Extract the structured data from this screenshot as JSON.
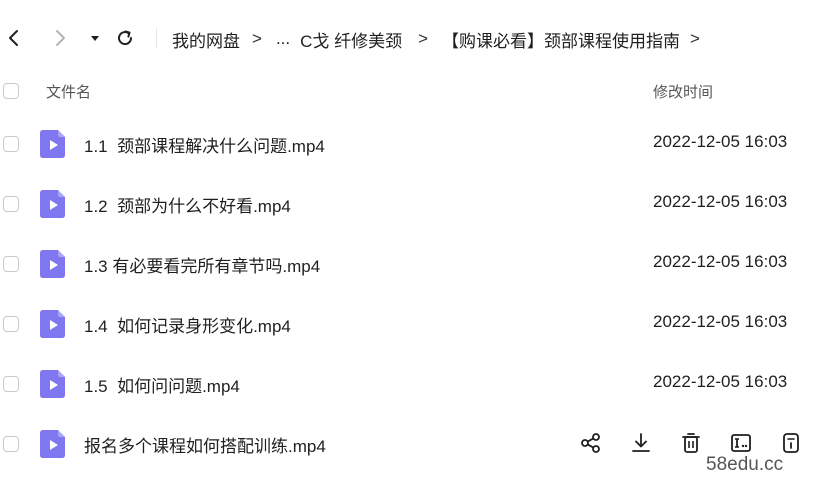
{
  "toolbar": {
    "back_icon": "chevron-left-icon",
    "forward_icon": "chevron-right-icon",
    "history_icon": "caret-down-icon",
    "refresh_icon": "refresh-icon"
  },
  "breadcrumb": {
    "items": [
      "我的网盘",
      "...",
      "C戈 纤修美颈",
      "【购课必看】颈部课程使用指南"
    ],
    "separator": ">"
  },
  "table": {
    "headers": {
      "name": "文件名",
      "modified": "修改时间"
    },
    "rows": [
      {
        "name": "1.1  颈部课程解决什么问题.mp4",
        "modified": "2022-12-05 16:03"
      },
      {
        "name": "1.2  颈部为什么不好看.mp4",
        "modified": "2022-12-05 16:03"
      },
      {
        "name": "1.3 有必要看完所有章节吗.mp4",
        "modified": "2022-12-05 16:03"
      },
      {
        "name": "1.4  如何记录身形变化.mp4",
        "modified": "2022-12-05 16:03"
      },
      {
        "name": "1.5  如何问问题.mp4",
        "modified": "2022-12-05 16:03"
      },
      {
        "name": "报名多个课程如何搭配训练.mp4",
        "modified": ""
      }
    ],
    "hover_actions": [
      "share-icon",
      "download-icon",
      "delete-icon",
      "rename-icon",
      "more-icon"
    ]
  },
  "colors": {
    "file_icon": "#7f77f0",
    "text": "#1f1f1f",
    "border": "#c9c9c9"
  },
  "watermark": "58edu.cc"
}
